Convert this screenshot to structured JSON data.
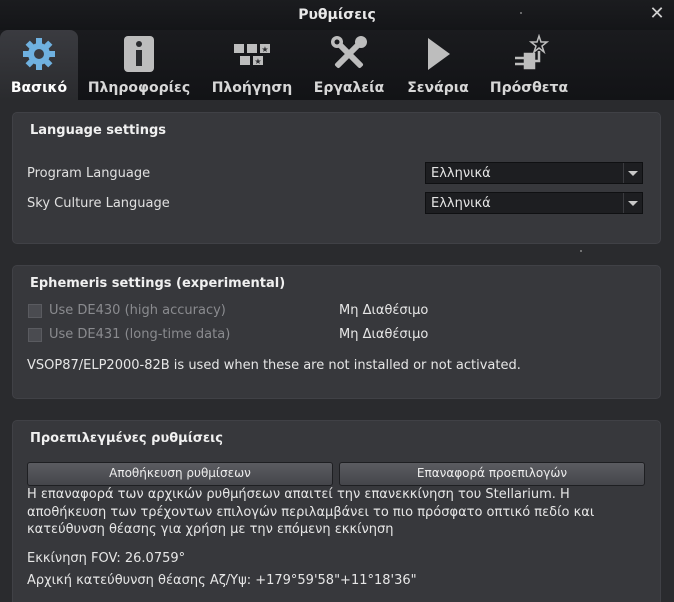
{
  "window": {
    "title": "Ρυθμίσεις",
    "close_symbol": "✕"
  },
  "tabs": [
    {
      "label": "Βασικό",
      "icon": "gear-icon"
    },
    {
      "label": "Πληροφορίες",
      "icon": "info-icon"
    },
    {
      "label": "Πλοήγηση",
      "icon": "keyboard-icon"
    },
    {
      "label": "Εργαλεία",
      "icon": "tools-icon"
    },
    {
      "label": "Σενάρια",
      "icon": "play-icon"
    },
    {
      "label": "Πρόσθετα",
      "icon": "plugin-icon"
    }
  ],
  "language": {
    "title": "Language settings",
    "program_label": "Program Language",
    "program_value": "Ελληνικά",
    "sky_label": "Sky Culture Language",
    "sky_value": "Ελληνικά"
  },
  "ephemeris": {
    "title": "Ephemeris settings (experimental)",
    "de430_label": "Use DE430 (high accuracy)",
    "de430_status": "Μη Διαθέσιμο",
    "de431_label": "Use DE431 (long-time data)",
    "de431_status": "Μη Διαθέσιμο",
    "note": "VSOP87/ELP2000-82B is used when these are not installed or not activated."
  },
  "defaults": {
    "title": "Προεπιλεγμένες ρυθμίσεις",
    "save_button": "Αποθήκευση ρυθμίσεων",
    "restore_button": "Επαναφορά προεπιλογών",
    "line1": "Η επαναφορά των αρχικών ρυθμήσεων απαιτεί την επανεκκίνηση του Stellarium. Η",
    "line2": "αποθήκευση των τρέχοντων επιλογών περιλαμβάνει το πιο πρόσφατο οπτικό πεδίο και",
    "line3": "κατεύθυνση θέασης για χρήση με την επόμενη εκκίνηση",
    "fov": "Εκκίνηση FOV: 26.0759°",
    "direction": "Αρχική κατεύθυνση θέασης Αζ/Υψ: +179°59'58\"+11°18'36\""
  },
  "colors": {
    "accent": "#6fb1e0",
    "panel": "#37383c",
    "background": "#2a2b2e"
  }
}
